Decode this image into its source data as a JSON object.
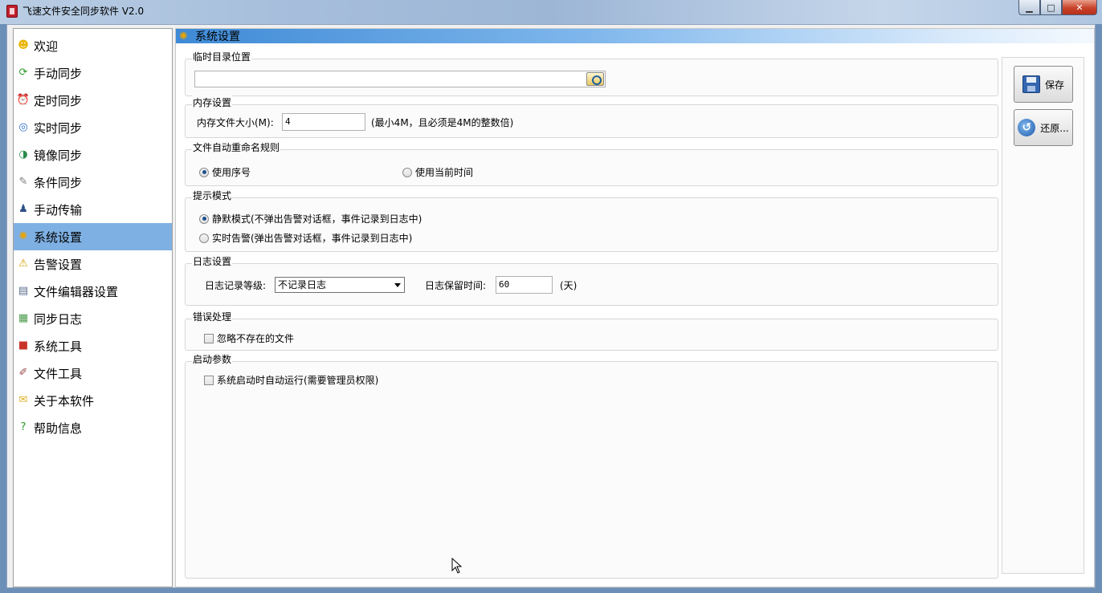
{
  "window": {
    "title": "飞速文件安全同步软件 V2.0",
    "minimize_glyph": "▁",
    "maximize_glyph": "□",
    "close_glyph": "✕"
  },
  "sidebar": {
    "items": [
      {
        "label": "欢迎",
        "icon": "smiley-icon",
        "glyph": "☻",
        "color": "#e8b400"
      },
      {
        "label": "手动同步",
        "icon": "sync-arrows-icon",
        "glyph": "⟳",
        "color": "#2a9a2a"
      },
      {
        "label": "定时同步",
        "icon": "alarm-clock-icon",
        "glyph": "⏰",
        "color": "#c83030"
      },
      {
        "label": "实时同步",
        "icon": "compass-icon",
        "glyph": "◎",
        "color": "#2b6fd0"
      },
      {
        "label": "镜像同步",
        "icon": "mirror-icon",
        "glyph": "◑",
        "color": "#2a8c4a"
      },
      {
        "label": "条件同步",
        "icon": "document-edit-icon",
        "glyph": "✎",
        "color": "#7a7a7a"
      },
      {
        "label": "手动传输",
        "icon": "user-icon",
        "glyph": "♟",
        "color": "#2d4f86"
      },
      {
        "label": "系统设置",
        "icon": "gear-icon",
        "glyph": "✺",
        "color": "#e8a400"
      },
      {
        "label": "告警设置",
        "icon": "warning-icon",
        "glyph": "⚠",
        "color": "#d4a000"
      },
      {
        "label": "文件编辑器设置",
        "icon": "file-settings-icon",
        "glyph": "▤",
        "color": "#5a6e8c"
      },
      {
        "label": "同步日志",
        "icon": "log-icon",
        "glyph": "▦",
        "color": "#4a9a4a"
      },
      {
        "label": "系统工具",
        "icon": "toolbox-icon",
        "glyph": "■",
        "color": "#c8342a"
      },
      {
        "label": "文件工具",
        "icon": "file-tool-icon",
        "glyph": "✐",
        "color": "#9a4a4a"
      },
      {
        "label": "关于本软件",
        "icon": "about-icon",
        "glyph": "✉",
        "color": "#e0b020"
      },
      {
        "label": "帮助信息",
        "icon": "help-icon",
        "glyph": "?",
        "color": "#2a9a2a"
      }
    ],
    "active_index": 7
  },
  "header": {
    "title": "系统设置",
    "icon": "gear-icon"
  },
  "temp_dir": {
    "title": "临时目录位置",
    "value": ""
  },
  "memory": {
    "title": "内存设置",
    "label": "内存文件大小(M):",
    "value": "4",
    "hint": "(最小4M，且必须是4M的整数倍)"
  },
  "rename": {
    "title": "文件自动重命名规则",
    "option_serial": "使用序号",
    "option_time": "使用当前时间",
    "selected": "serial"
  },
  "prompt": {
    "title": "提示模式",
    "option_silent": "静默模式(不弹出告警对话框，事件记录到日志中)",
    "option_realtime": "实时告警(弹出告警对话框，事件记录到日志中)",
    "selected": "silent"
  },
  "log": {
    "title": "日志设置",
    "level_label": "日志记录等级:",
    "level_value": "不记录日志",
    "retain_label": "日志保留时间:",
    "retain_value": "60",
    "retain_unit": "(天)"
  },
  "error": {
    "title": "错误处理",
    "ignore_missing": "忽略不存在的文件",
    "ignore_missing_checked": false
  },
  "startup": {
    "title": "启动参数",
    "auto_run": "系统启动时自动运行(需要管理员权限)",
    "auto_run_checked": false
  },
  "actions": {
    "save": "保存",
    "restore": "还原..."
  }
}
